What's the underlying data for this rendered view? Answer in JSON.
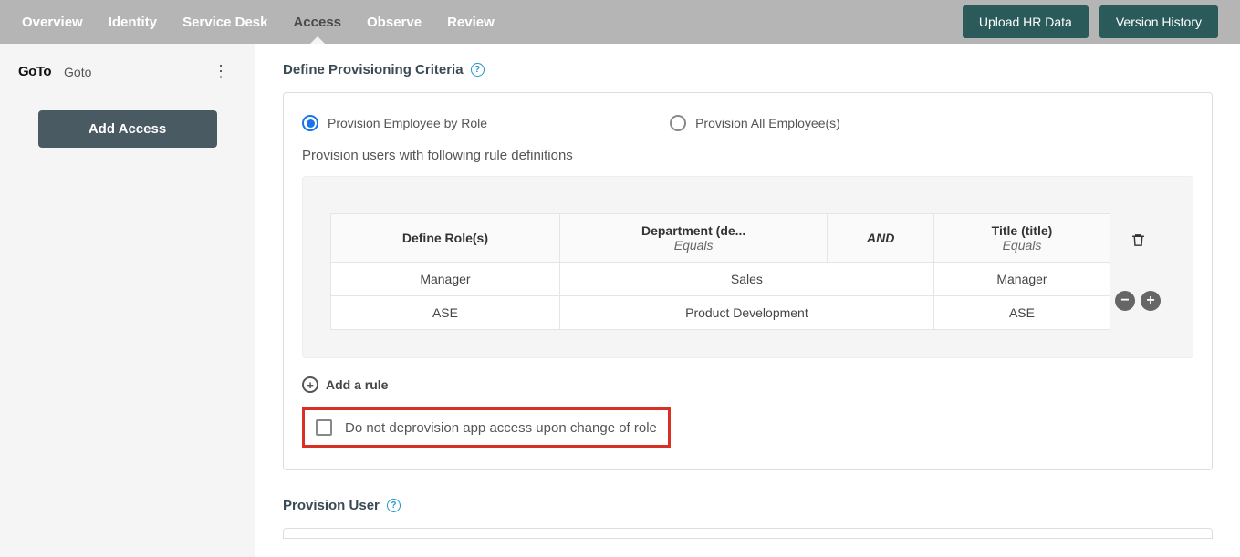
{
  "topnav": {
    "tabs": [
      "Overview",
      "Identity",
      "Service Desk",
      "Access",
      "Observe",
      "Review"
    ],
    "active_index": 3,
    "upload_btn": "Upload HR Data",
    "version_btn": "Version History"
  },
  "sidebar": {
    "logo_text": "GoTo",
    "app_name": "Goto",
    "add_access_btn": "Add Access"
  },
  "criteria": {
    "title": "Define Provisioning Criteria",
    "radio_by_role": "Provision Employee by Role",
    "radio_all": "Provision All Employee(s)",
    "caption": "Provision users with following rule definitions",
    "headers": {
      "define_roles": "Define Role(s)",
      "department": "Department (de...",
      "equals1": "Equals",
      "and": "AND",
      "title_col": "Title (title)",
      "equals2": "Equals"
    },
    "rows": [
      {
        "role": "Manager",
        "dept": "Sales",
        "title": "Manager"
      },
      {
        "role": "ASE",
        "dept": "Product Development",
        "title": "ASE"
      }
    ],
    "add_rule": "Add a rule",
    "deprov_label": "Do not deprovision app access upon change of role"
  },
  "provision_user": {
    "title": "Provision User"
  }
}
